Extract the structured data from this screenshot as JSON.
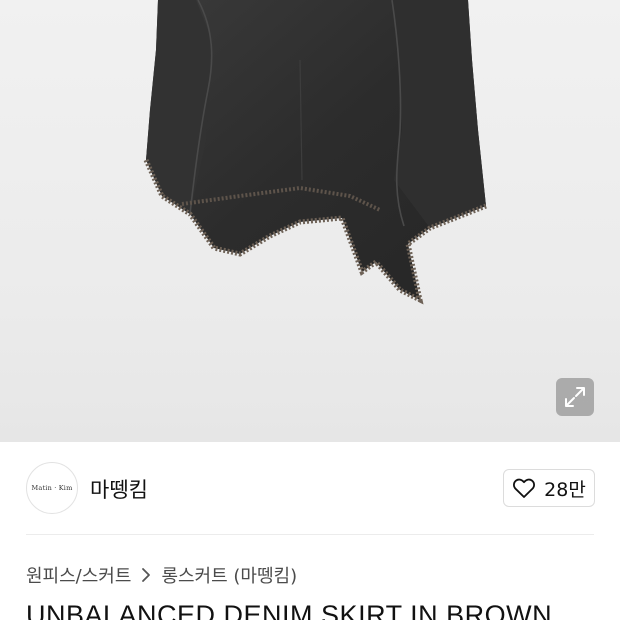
{
  "brand": {
    "logo_text": "Matin · Kim",
    "name": "마뗑킴"
  },
  "like": {
    "count": "28만",
    "icon": "heart-outline-icon"
  },
  "hero": {
    "expand_icon": "expand-arrows-icon"
  },
  "breadcrumb": {
    "items": [
      "원피스/스커트",
      "롱스커트 (마뗑킴)"
    ],
    "separator_icon": "chevron-right-icon"
  },
  "product": {
    "title": "UNBALANCED DENIM SKIRT IN BROWN"
  }
}
